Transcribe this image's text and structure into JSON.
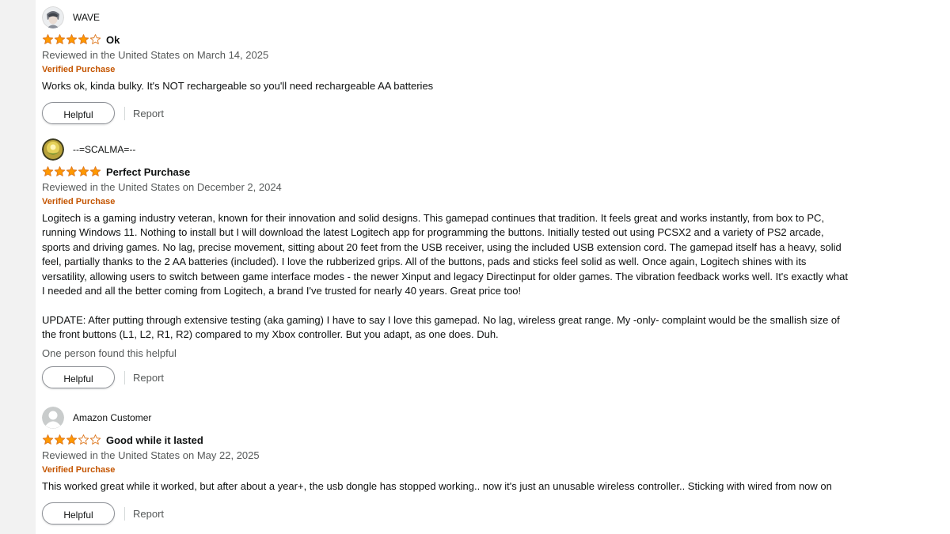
{
  "reviews": [
    {
      "profile_name": "WAVE",
      "avatar_icon": "stylized-person-avatar-icon",
      "rating": 4,
      "rating_max": 5,
      "title": "Ok",
      "date": "Reviewed in the United States on March 14, 2025",
      "verified": "Verified Purchase",
      "body": [
        "Works ok, kinda bulky. It's NOT rechargeable so you'll need rechargeable AA batteries"
      ],
      "helpful_count": "",
      "helpful_label": "Helpful",
      "report_label": "Report"
    },
    {
      "profile_name": "--=SCALMA=--",
      "avatar_icon": "gold-emblem-avatar-icon",
      "rating": 5,
      "rating_max": 5,
      "title": "Perfect Purchase",
      "date": "Reviewed in the United States on December 2, 2024",
      "verified": "Verified Purchase",
      "body": [
        "Logitech is a gaming industry veteran, known for their innovation and solid designs. This gamepad continues that tradition. It feels great and works instantly, from box to PC, running Windows 11. Nothing to install but I will download the latest Logitech app for programming the buttons. Initially tested out using PCSX2 and a variety of PS2 arcade, sports and driving games. No lag, precise movement, sitting about 20 feet from the USB receiver, using the included USB extension cord. The gamepad itself has a heavy, solid feel, partially thanks to the 2 AA batteries (included). I love the rubberized grips. All of the buttons, pads and sticks feel solid as well. Once again, Logitech shines with its versatility, allowing users to switch between game interface modes - the newer Xinput and legacy Directinput for older games. The vibration feedback works well. It's exactly what I needed and all the better coming from Logitech, a brand I've trusted for nearly 40 years. Great price too!",
        "UPDATE: After putting through extensive testing (aka gaming) I have to say I love this gamepad. No lag, wireless great range. My -only- complaint would be the smallish size of the front buttons (L1, L2, R1, R2) compared to my Xbox controller. But you adapt, as one does. Duh."
      ],
      "helpful_count": "One person found this helpful",
      "helpful_label": "Helpful",
      "report_label": "Report"
    },
    {
      "profile_name": "Amazon Customer",
      "avatar_icon": "default-user-avatar-icon",
      "rating": 3,
      "rating_max": 5,
      "title": "Good while it lasted",
      "date": "Reviewed in the United States on May 22, 2025",
      "verified": "Verified Purchase",
      "body": [
        "This worked great while it worked, but after about a year+, the usb dongle has stopped working.. now it's just an unusable wireless controller.. Sticking with wired from now on"
      ],
      "helpful_count": "",
      "helpful_label": "Helpful",
      "report_label": "Report"
    }
  ],
  "colors": {
    "star_filled": "#ff9900",
    "star_outline": "#de7921",
    "verified": "#c45500",
    "muted_text": "#565959"
  }
}
